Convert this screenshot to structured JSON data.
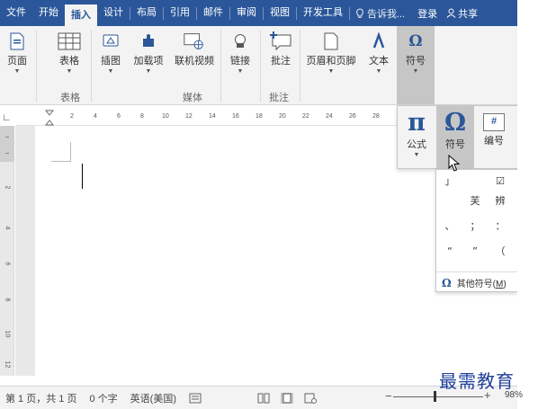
{
  "tabs": [
    {
      "label": "文件",
      "active": false
    },
    {
      "label": "开始",
      "active": false
    },
    {
      "label": "插入",
      "active": true
    },
    {
      "label": "设计",
      "active": false
    },
    {
      "label": "布局",
      "active": false
    },
    {
      "label": "引用",
      "active": false
    },
    {
      "label": "邮件",
      "active": false
    },
    {
      "label": "审阅",
      "active": false
    },
    {
      "label": "视图",
      "active": false
    },
    {
      "label": "开发工具",
      "active": false
    }
  ],
  "tellme": "告诉我...",
  "login": "登录",
  "share": "共享",
  "ribbon": {
    "buttons": [
      {
        "label": "页面",
        "icon": "page-icon",
        "dropdown": true
      },
      {
        "label": "表格",
        "icon": "table-icon",
        "dropdown": true
      },
      {
        "label": "插图",
        "icon": "illustration-icon",
        "dropdown": true
      },
      {
        "label": "加载项",
        "icon": "addin-icon",
        "dropdown": true
      },
      {
        "label": "联机视频",
        "icon": "online-video-icon",
        "dropdown": false
      },
      {
        "label": "链接",
        "icon": "link-icon",
        "dropdown": true
      },
      {
        "label": "批注",
        "icon": "comment-icon",
        "dropdown": false
      },
      {
        "label": "页眉和页脚",
        "icon": "header-footer-icon",
        "dropdown": true
      },
      {
        "label": "文本",
        "icon": "text-icon",
        "dropdown": true
      },
      {
        "label": "符号",
        "icon": "omega-icon",
        "dropdown": true
      }
    ],
    "groups": {
      "tables": "表格",
      "media": "媒体",
      "comments": "批注"
    }
  },
  "ruler_ticks": [
    "2",
    "4",
    "6",
    "8",
    "10",
    "12",
    "14",
    "16",
    "18",
    "20",
    "22",
    "24",
    "26",
    "28"
  ],
  "vruler_ticks": [
    "2",
    "4",
    "6",
    "8",
    "10",
    "12"
  ],
  "symbols_panel": {
    "equation": {
      "label": "公式",
      "glyph": "π"
    },
    "symbol": {
      "label": "符号",
      "glyph": "Ω"
    },
    "number": {
      "label": "编号",
      "glyph": "#"
    }
  },
  "symbol_grid": [
    "」",
    "☑",
    "",
    "芙",
    "辨",
    "、",
    "；",
    "：",
    "“",
    "”",
    "（"
  ],
  "more_symbols": {
    "glyph": "Ω",
    "label": "其他符号(",
    "accel": "M",
    "tail": ")"
  },
  "status": {
    "page": "第 1 页，共 1 页",
    "words": "0 个字",
    "language": "英语(美国)",
    "zoom": "98%",
    "zoom_level": 0.46
  },
  "watermark": "最需教育"
}
